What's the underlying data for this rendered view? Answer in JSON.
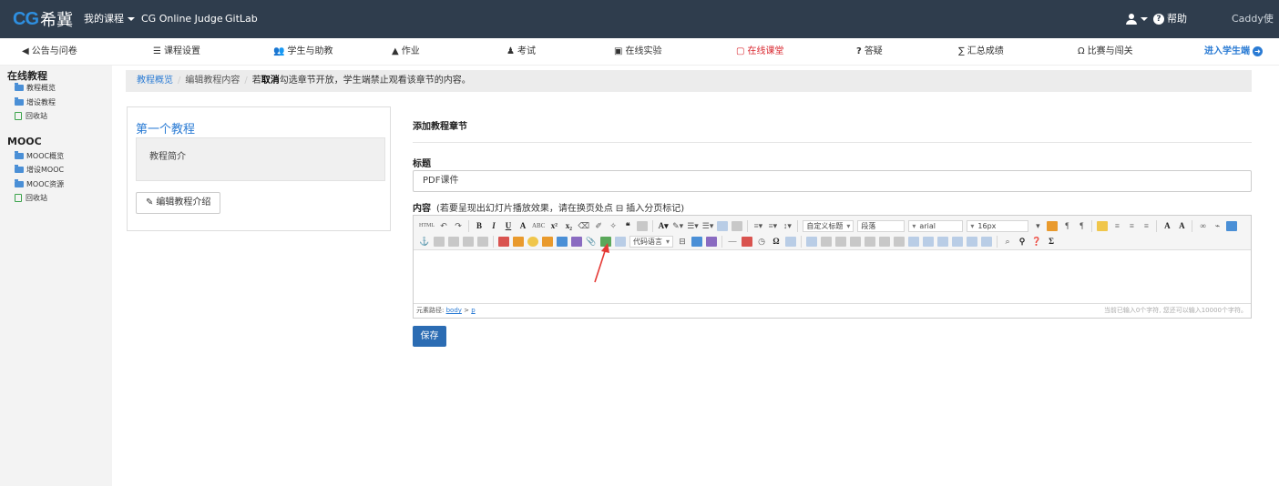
{
  "topbar": {
    "logo_mark": "CG",
    "logo_text": "希冀",
    "my_courses": "我的课程",
    "links": [
      "CG Online Judge",
      "GitLab"
    ],
    "help": "帮助",
    "username": "Caddy使用"
  },
  "secnav": {
    "items": [
      {
        "label": "公告与问卷",
        "icon": "megaphone-icon"
      },
      {
        "label": "课程设置",
        "icon": "list-icon"
      },
      {
        "label": "学生与助教",
        "icon": "users-icon"
      },
      {
        "label": "作业",
        "icon": "homework-icon"
      },
      {
        "label": "考试",
        "icon": "exam-icon"
      },
      {
        "label": "在线实验",
        "icon": "monitor-icon"
      },
      {
        "label": "在线课堂",
        "icon": "classroom-icon"
      },
      {
        "label": "答疑",
        "icon": "question-icon"
      },
      {
        "label": "汇总成绩",
        "icon": "sigma-icon"
      },
      {
        "label": "比赛与闯关",
        "icon": "trophy-icon"
      }
    ],
    "student_view": "进入学生端",
    "active_color": "#d9262e",
    "link_color": "#2a7bd4"
  },
  "sidebar": {
    "groups": [
      {
        "title": "在线教程",
        "items": [
          "教程概览",
          "增设教程",
          "回收站"
        ]
      },
      {
        "title": "MOOC",
        "items": [
          "MOOC概览",
          "增设MOOC",
          "MOOC资源",
          "回收站"
        ]
      }
    ]
  },
  "breadcrumb": {
    "link": "教程概览",
    "current": "编辑教程内容",
    "tip_prefix": "若",
    "tip_bold": "取消",
    "tip_suffix": "勾选章节开放，学生端禁止观看该章节的内容。"
  },
  "tutorial": {
    "title": "第一个教程",
    "intro": "教程简介",
    "edit_button": "编辑教程介绍"
  },
  "form": {
    "section_title": "添加教程章节",
    "title_label": "标题",
    "title_value": "PDF课件",
    "content_label": "内容",
    "content_hint": "(若要呈现出幻灯片播放效果，请在换页处点",
    "content_hint2": "插入分页标记)",
    "save": "保存"
  },
  "editor": {
    "style_select": "自定义标题",
    "para_select": "段落",
    "font_select": "arial",
    "size_select": "16px",
    "code_select": "代码语言",
    "status_label": "元素路径:",
    "status_path_a": "body",
    "status_path_sep": ">",
    "status_path_b": "p",
    "char_count": "当前已输入0个字符, 您还可以输入10000个字符。"
  }
}
